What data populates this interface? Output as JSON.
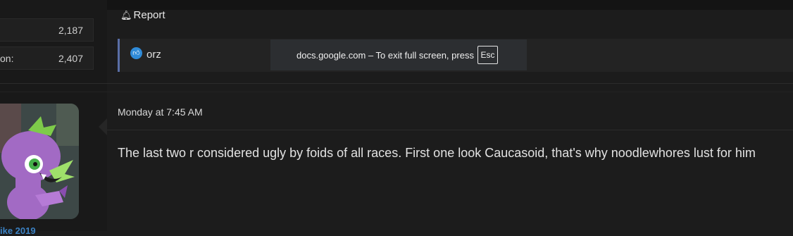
{
  "stats": [
    {
      "label": "",
      "value": "2,187"
    },
    {
      "label": "on:",
      "value": "2,407"
    }
  ],
  "post_actions": {
    "report_label": "Report"
  },
  "reactions": {
    "users": "orz"
  },
  "fullscreen_notice": {
    "message": "docs.google.com – To exit full screen, press",
    "key": "Esc"
  },
  "post": {
    "date": "Monday at 7:45 AM",
    "body": "The last two r considered ugly by foids of all races. First one look Caucasoid, that's why noodlewhores lust for him"
  },
  "author": {
    "name_partial": "ike 2019"
  },
  "colors": {
    "like_blue": "#2f8bd8",
    "reaction_border": "#5a6ea6",
    "username_blue": "#3b82c4"
  },
  "icons": {
    "report": "bell-icon",
    "like": "thumbs-up-icon"
  }
}
